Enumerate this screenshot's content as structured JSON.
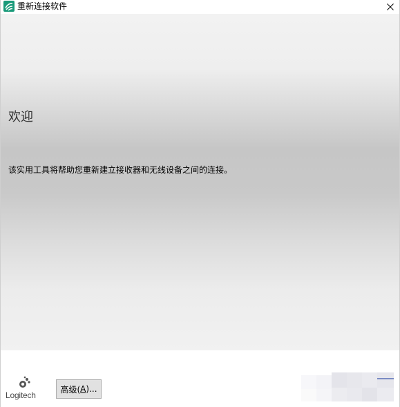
{
  "window": {
    "title": "重新连接软件",
    "app_icon": "logitech-app-icon",
    "close_icon": "close-icon"
  },
  "main": {
    "heading": "欢迎",
    "description": "该实用工具将帮助您重新建立接收器和无线设备之间的连接。"
  },
  "footer": {
    "logo_text": "Logitech",
    "advanced_button": {
      "prefix": "高级(",
      "mnemonic": "A",
      "suffix": ")..."
    }
  },
  "colors": {
    "icon_teal": "#1a9a7a",
    "button_bg": "#e1e1e1",
    "button_border": "#adadad",
    "gradient_mid": "#c6c6c6"
  }
}
